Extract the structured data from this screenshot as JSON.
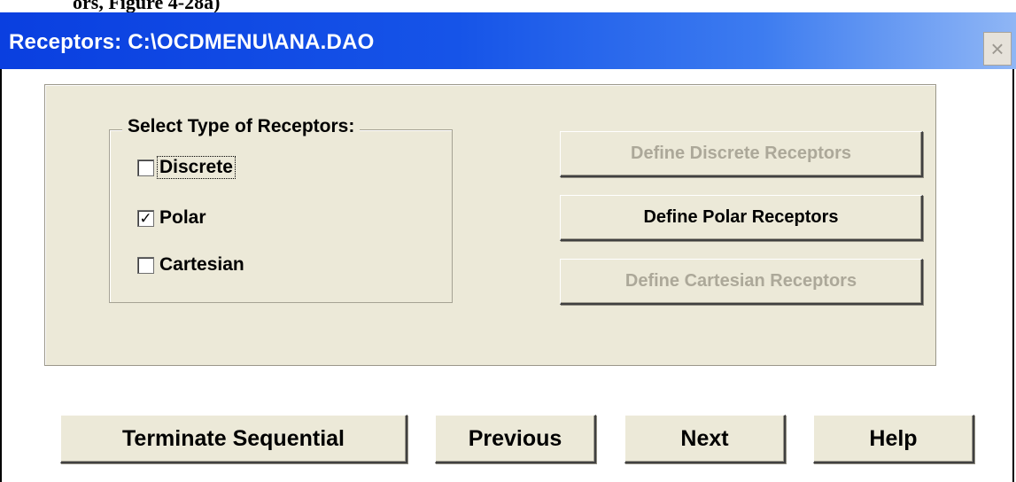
{
  "caption_fragment": "ors, Figure 4-28a)",
  "window": {
    "title": "Receptors: C:\\OCDMENU\\ANA.DAO",
    "close_glyph": "×"
  },
  "group": {
    "legend": "Select Type of Receptors:",
    "options": [
      {
        "label": "Discrete",
        "checked": false,
        "mark": ""
      },
      {
        "label": "Polar",
        "checked": true,
        "mark": "✓"
      },
      {
        "label": "Cartesian",
        "checked": false,
        "mark": ""
      }
    ]
  },
  "define_buttons": {
    "discrete": {
      "label": "Define Discrete Receptors",
      "enabled": false
    },
    "polar": {
      "label": "Define Polar Receptors",
      "enabled": true
    },
    "cartesian": {
      "label": "Define Cartesian Receptors",
      "enabled": false
    }
  },
  "footer_buttons": {
    "terminate": "Terminate Sequential",
    "previous": "Previous",
    "next": "Next",
    "help": "Help"
  },
  "colors": {
    "title_gradient_start": "#0a3fe0",
    "title_gradient_end": "#8fb6f5",
    "dialog_face": "#ece9d8",
    "disabled_text": "#aca899"
  }
}
